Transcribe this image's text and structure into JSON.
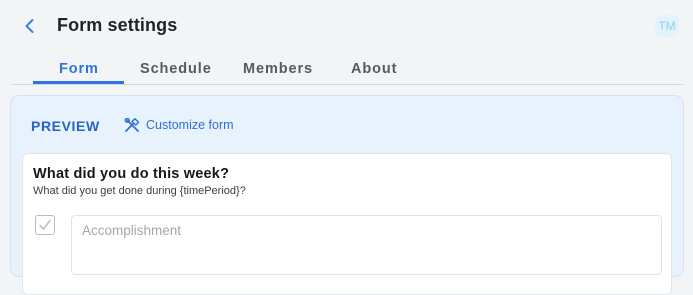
{
  "header": {
    "title": "Form settings",
    "avatar_initials": "TM",
    "back_icon": "chevron-left-icon"
  },
  "tabs": [
    {
      "label": "Form",
      "active": true
    },
    {
      "label": "Schedule",
      "active": false
    },
    {
      "label": "Members",
      "active": false
    },
    {
      "label": "About",
      "active": false
    }
  ],
  "preview": {
    "label": "PREVIEW",
    "customize_label": "Customize form",
    "customize_icon": "tools-icon"
  },
  "question": {
    "title": "What did you do this week?",
    "description": "What did you get done during {timePeriod}?",
    "checkbox_icon": "checkmark-icon",
    "input_placeholder": "Accomplishment",
    "input_value": ""
  },
  "colors": {
    "accent": "#2f73e0",
    "panel_background": "#e8f2fd",
    "page_background": "#f3f4f6"
  }
}
